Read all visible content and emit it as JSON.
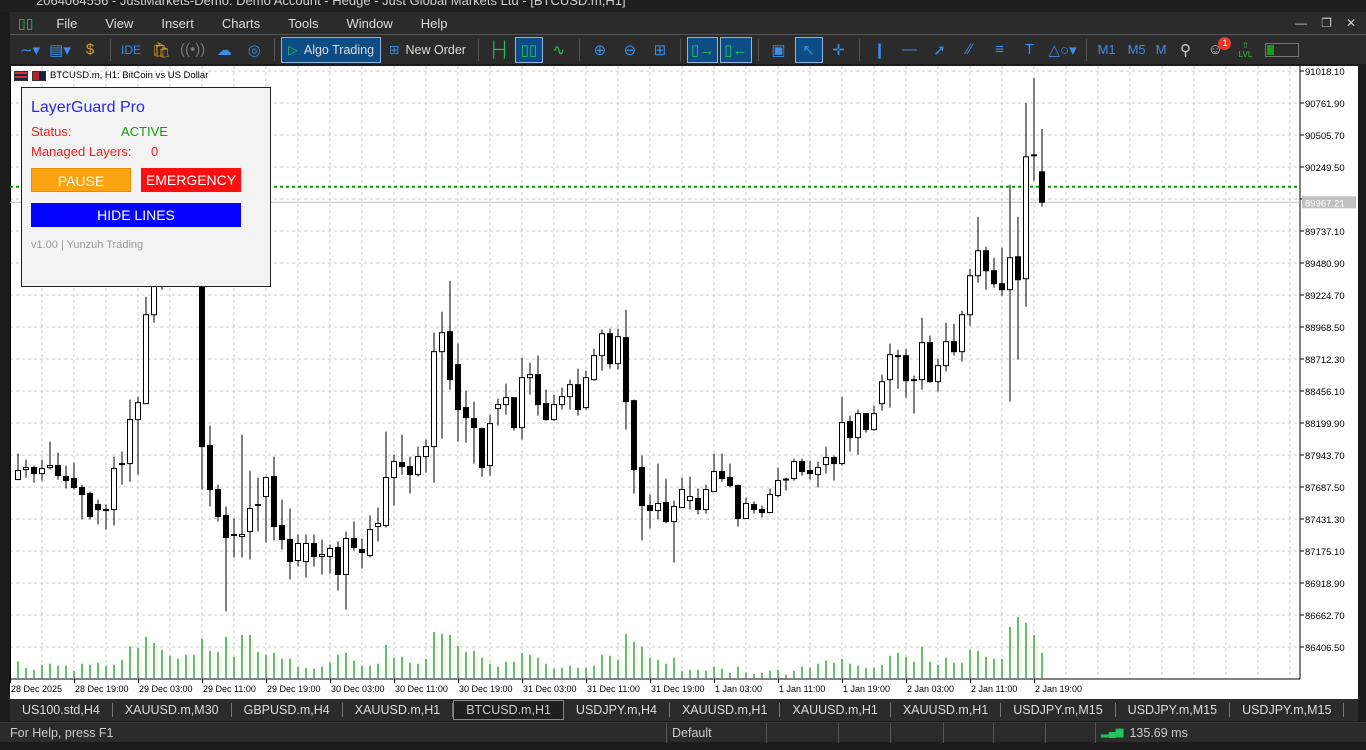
{
  "window": {
    "title": "2064064556 - JustMarkets-Demo: Demo Account - Hedge - Just Global Markets Ltd - [BTCUSD.m,H1]"
  },
  "menu": [
    "File",
    "View",
    "Insert",
    "Charts",
    "Tools",
    "Window",
    "Help"
  ],
  "toolbar": {
    "ide": "IDE",
    "algo_trading": "Algo Trading",
    "new_order": "New Order",
    "timeframes": [
      "M1",
      "M5",
      "M"
    ],
    "notification_count": "1",
    "lvl": "LVL"
  },
  "chart": {
    "caption": "BTCUSD.m, H1:  BitCoin vs US Dollar",
    "current_price": "89967.21",
    "current_price_value": 89967.21,
    "green_level": 90091,
    "colors": {
      "bull_body": "#ffffff",
      "bear_body": "#000000",
      "volume": "#1a9b1a",
      "level_line": "#0a9a0a",
      "bid_line": "#c0c0c0",
      "marker_sell": "#e8502a",
      "marker_buy": "#1e6fc8"
    }
  },
  "chart_data": {
    "type": "candlestick",
    "timeframe": "H1",
    "price_ticks": [
      "91018.10",
      "90761.90",
      "90505.70",
      "90249.50",
      "89993.30",
      "89737.10",
      "89480.90",
      "89224.70",
      "88968.50",
      "88712.30",
      "88456.10",
      "88199.90",
      "87943.70",
      "87687.50",
      "87431.30",
      "87175.10",
      "86918.90",
      "86662.70",
      "86406.50"
    ],
    "time_ticks": [
      "28 Dec 2025",
      "28 Dec 19:00",
      "29 Dec 03:00",
      "29 Dec 11:00",
      "29 Dec 19:00",
      "30 Dec 03:00",
      "30 Dec 11:00",
      "30 Dec 19:00",
      "31 Dec 03:00",
      "31 Dec 11:00",
      "31 Dec 19:00",
      "1 Jan 03:00",
      "1 Jan 11:00",
      "1 Jan 19:00",
      "2 Jan 03:00",
      "2 Jan 11:00",
      "2 Jan 19:00"
    ],
    "ylim": [
      86330,
      91060
    ],
    "grid": true,
    "ohlc": [
      [
        87747,
        87955,
        87747,
        87819
      ],
      [
        87827,
        87907,
        87763,
        87843
      ],
      [
        87843,
        87859,
        87723,
        87795
      ],
      [
        87795,
        87907,
        87739,
        87835
      ],
      [
        87843,
        88051,
        87827,
        87859
      ],
      [
        87859,
        87963,
        87747,
        87779
      ],
      [
        87771,
        87859,
        87675,
        87739
      ],
      [
        87755,
        87883,
        87667,
        87683
      ],
      [
        87683,
        87707,
        87427,
        87627
      ],
      [
        87635,
        87651,
        87427,
        87451
      ],
      [
        87547,
        87587,
        87387,
        87507
      ],
      [
        87507,
        87547,
        87347,
        87507
      ],
      [
        87507,
        87931,
        87379,
        87835
      ],
      [
        87867,
        87971,
        87707,
        87875
      ],
      [
        87875,
        88387,
        87731,
        88227
      ],
      [
        88227,
        88411,
        87787,
        88363
      ],
      [
        88355,
        89211,
        88387,
        89067
      ],
      [
        89067,
        89587,
        89003,
        89347
      ],
      [
        89347,
        89907,
        89267,
        89747
      ],
      [
        89747,
        90147,
        89667,
        89987
      ],
      [
        89987,
        90067,
        89747,
        89867
      ],
      [
        89867,
        90187,
        89827,
        90067
      ],
      [
        90067,
        90107,
        89347,
        89427
      ],
      [
        89427,
        89467,
        87667,
        88011
      ],
      [
        88019,
        88179,
        87531,
        87667
      ],
      [
        87667,
        87707,
        87411,
        87451
      ],
      [
        87459,
        87531,
        86691,
        87283
      ],
      [
        87307,
        87435,
        87123,
        87299
      ],
      [
        87291,
        88107,
        87123,
        87307
      ],
      [
        87331,
        87819,
        87107,
        87515
      ],
      [
        87547,
        87763,
        87331,
        87547
      ],
      [
        87611,
        87771,
        87243,
        87763
      ],
      [
        87771,
        87931,
        87259,
        87371
      ],
      [
        87379,
        87587,
        87187,
        87267
      ],
      [
        87267,
        87515,
        86947,
        87091
      ],
      [
        87099,
        87307,
        87051,
        87235
      ],
      [
        87091,
        87307,
        86963,
        87235
      ],
      [
        87235,
        87307,
        87051,
        87131
      ],
      [
        87131,
        87267,
        86987,
        87147
      ],
      [
        87131,
        87227,
        86995,
        87195
      ],
      [
        87203,
        87251,
        86859,
        86987
      ],
      [
        86987,
        87331,
        86707,
        87275
      ],
      [
        87275,
        87411,
        87179,
        87203
      ],
      [
        87187,
        87275,
        87035,
        87163
      ],
      [
        87139,
        87459,
        87123,
        87347
      ],
      [
        87371,
        87523,
        87251,
        87395
      ],
      [
        87379,
        88131,
        87363,
        87763
      ],
      [
        87763,
        87947,
        87539,
        87891
      ],
      [
        87883,
        88107,
        87787,
        87851
      ],
      [
        87851,
        87931,
        87635,
        87787
      ],
      [
        87787,
        88011,
        87771,
        87931
      ],
      [
        87931,
        88067,
        87803,
        88011
      ],
      [
        88011,
        88923,
        87723,
        88771
      ],
      [
        88771,
        89091,
        88075,
        88923
      ],
      [
        88931,
        89339,
        88467,
        88547
      ],
      [
        88667,
        88835,
        88051,
        88307
      ],
      [
        88323,
        88459,
        88043,
        88243
      ],
      [
        88235,
        88371,
        87875,
        88163
      ],
      [
        88155,
        88163,
        87771,
        87843
      ],
      [
        87859,
        88267,
        87779,
        88195
      ],
      [
        88315,
        88395,
        88179,
        88347
      ],
      [
        88347,
        88515,
        88267,
        88403
      ],
      [
        88403,
        88403,
        88139,
        88163
      ],
      [
        88163,
        88723,
        88067,
        88563
      ],
      [
        88563,
        88683,
        88427,
        88587
      ],
      [
        88587,
        88739,
        88259,
        88347
      ],
      [
        88355,
        88467,
        88219,
        88227
      ],
      [
        88227,
        88427,
        88219,
        88347
      ],
      [
        88347,
        88483,
        88307,
        88411
      ],
      [
        88411,
        88547,
        88307,
        88507
      ],
      [
        88507,
        88635,
        88259,
        88307
      ],
      [
        88323,
        88619,
        88307,
        88563
      ],
      [
        88547,
        88795,
        88539,
        88739
      ],
      [
        88739,
        88947,
        88619,
        88915
      ],
      [
        88915,
        88955,
        88635,
        88675
      ],
      [
        88675,
        88955,
        88627,
        88891
      ],
      [
        88883,
        89107,
        88147,
        88371
      ],
      [
        88379,
        88387,
        87635,
        87827
      ],
      [
        87843,
        87939,
        87259,
        87539
      ],
      [
        87539,
        87627,
        87355,
        87499
      ],
      [
        87499,
        87875,
        87427,
        87555
      ],
      [
        87563,
        87755,
        87395,
        87411
      ],
      [
        87411,
        87579,
        87083,
        87531
      ],
      [
        87523,
        87763,
        87523,
        87667
      ],
      [
        87579,
        87771,
        87507,
        87611
      ],
      [
        87595,
        87675,
        87467,
        87507
      ],
      [
        87507,
        87707,
        87475,
        87667
      ],
      [
        87651,
        87955,
        87651,
        87811
      ],
      [
        87811,
        87955,
        87731,
        87755
      ],
      [
        87763,
        87875,
        87683,
        87699
      ],
      [
        87699,
        87707,
        87371,
        87435
      ],
      [
        87435,
        87603,
        87435,
        87555
      ],
      [
        87547,
        87571,
        87475,
        87507
      ],
      [
        87507,
        87539,
        87443,
        87483
      ],
      [
        87483,
        87675,
        87483,
        87627
      ],
      [
        87619,
        87843,
        87603,
        87739
      ],
      [
        87747,
        87763,
        87659,
        87751
      ],
      [
        87755,
        87915,
        87739,
        87891
      ],
      [
        87891,
        87915,
        87779,
        87811
      ],
      [
        87819,
        87899,
        87747,
        87795
      ],
      [
        87787,
        87891,
        87683,
        87843
      ],
      [
        87867,
        88011,
        87795,
        87923
      ],
      [
        87923,
        87939,
        87739,
        87875
      ],
      [
        87875,
        88411,
        87859,
        88203
      ],
      [
        88211,
        88259,
        87971,
        88083
      ],
      [
        88083,
        88307,
        87947,
        88275
      ],
      [
        88275,
        88275,
        88123,
        88147
      ],
      [
        88147,
        88339,
        88139,
        88275
      ],
      [
        88355,
        88587,
        88299,
        88531
      ],
      [
        88547,
        88835,
        88323,
        88747
      ],
      [
        88739,
        88787,
        88475,
        88731
      ],
      [
        88739,
        88795,
        88403,
        88539
      ],
      [
        88539,
        88579,
        88275,
        88547
      ],
      [
        88547,
        89043,
        88467,
        88843
      ],
      [
        88843,
        88899,
        88523,
        88531
      ],
      [
        88531,
        88715,
        88451,
        88659
      ],
      [
        88659,
        89003,
        88611,
        88851
      ],
      [
        88851,
        88995,
        88739,
        88771
      ],
      [
        88771,
        89099,
        88691,
        89067
      ],
      [
        89067,
        89435,
        88979,
        89379
      ],
      [
        89379,
        89851,
        89323,
        89579
      ],
      [
        89579,
        89611,
        89267,
        89419
      ],
      [
        89419,
        89523,
        89283,
        89315
      ],
      [
        89315,
        89603,
        89219,
        89267
      ],
      [
        89267,
        90107,
        88371,
        89523
      ],
      [
        89531,
        89851,
        88707,
        89347
      ],
      [
        89355,
        90763,
        89131,
        90331
      ],
      [
        90347,
        90963,
        90139,
        90339
      ],
      [
        90211,
        90555,
        89931,
        89967.21
      ]
    ],
    "volume": [
      50,
      30,
      25,
      40,
      43,
      37,
      37,
      22,
      43,
      40,
      46,
      37,
      40,
      55,
      95,
      90,
      124,
      106,
      85,
      67,
      58,
      70,
      70,
      118,
      82,
      79,
      124,
      64,
      130,
      130,
      79,
      70,
      76,
      58,
      58,
      34,
      31,
      28,
      34,
      46,
      70,
      76,
      52,
      37,
      37,
      43,
      100,
      61,
      64,
      46,
      43,
      58,
      139,
      133,
      130,
      97,
      79,
      82,
      61,
      43,
      34,
      49,
      49,
      76,
      70,
      61,
      43,
      28,
      31,
      37,
      31,
      31,
      37,
      70,
      67,
      55,
      133,
      109,
      94,
      61,
      55,
      43,
      61,
      21,
      25,
      25,
      22,
      34,
      28,
      16,
      34,
      16,
      13,
      16,
      22,
      25,
      10,
      22,
      34,
      31,
      43,
      52,
      46,
      58,
      43,
      37,
      31,
      31,
      40,
      67,
      76,
      64,
      49,
      94,
      49,
      40,
      61,
      46,
      46,
      85,
      82,
      64,
      58,
      58,
      154,
      184,
      166,
      130,
      76
    ]
  },
  "panel": {
    "title": "LayerGuard Pro",
    "status_label": "Status:",
    "status_value": "ACTIVE",
    "layers_label": "Managed Layers:",
    "layers_value": "0",
    "pause": "PAUSE",
    "emergency": "EMERGENCY",
    "hide_lines": "HIDE LINES",
    "version": "v1.00 | Yunzuh Trading"
  },
  "tabs": [
    {
      "label": "US100.std,H4"
    },
    {
      "label": "XAUUSD.m,M30"
    },
    {
      "label": "GBPUSD.m,H4"
    },
    {
      "label": "XAUUSD.m,H1"
    },
    {
      "label": "BTCUSD.m,H1",
      "active": true
    },
    {
      "label": "USDJPY.m,H4"
    },
    {
      "label": "XAUUSD.m,H1"
    },
    {
      "label": "XAUUSD.m,H1"
    },
    {
      "label": "XAUUSD.m,H1"
    },
    {
      "label": "USDJPY.m,M15"
    },
    {
      "label": "USDJPY.m,M15"
    },
    {
      "label": "USDJPY.m,M15"
    }
  ],
  "status": {
    "help": "For Help, press F1",
    "profile": "Default",
    "ping": "135.69 ms"
  }
}
